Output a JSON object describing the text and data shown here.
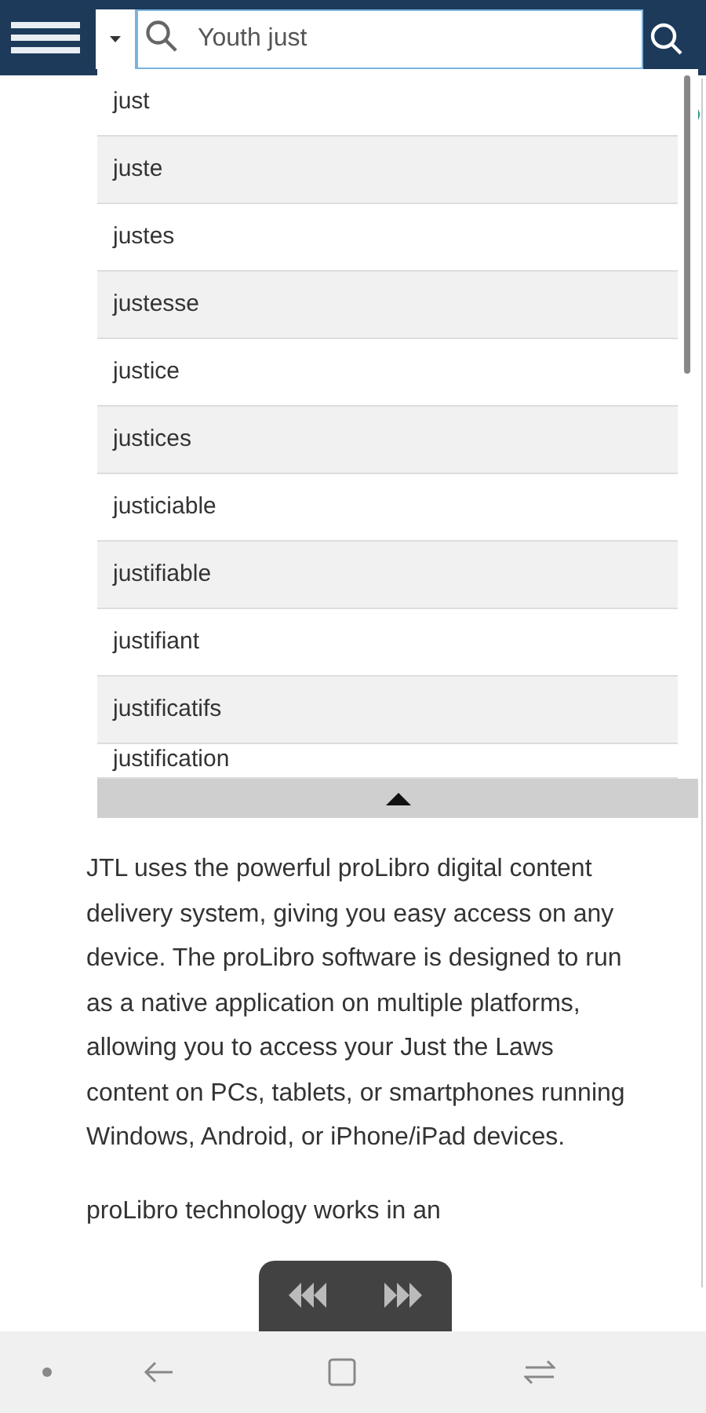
{
  "search": {
    "value": "Youth just"
  },
  "suggestions": [
    "just",
    "juste",
    "justes",
    "justesse",
    "justice",
    "justices",
    "justiciable",
    "justifiable",
    "justifiant",
    "justificatifs",
    "justification"
  ],
  "article": {
    "paragraphs": [
      "JTL uses the powerful proLibro digital content delivery system, giving you easy access on any device. The proLibro software is designed to run as a native application on multiple platforms, allowing you to access your Just the Laws content on PCs, tablets, or smartphones running Windows, Android, or iPhone/iPad devices.",
      "proLibro technology works in an"
    ]
  }
}
